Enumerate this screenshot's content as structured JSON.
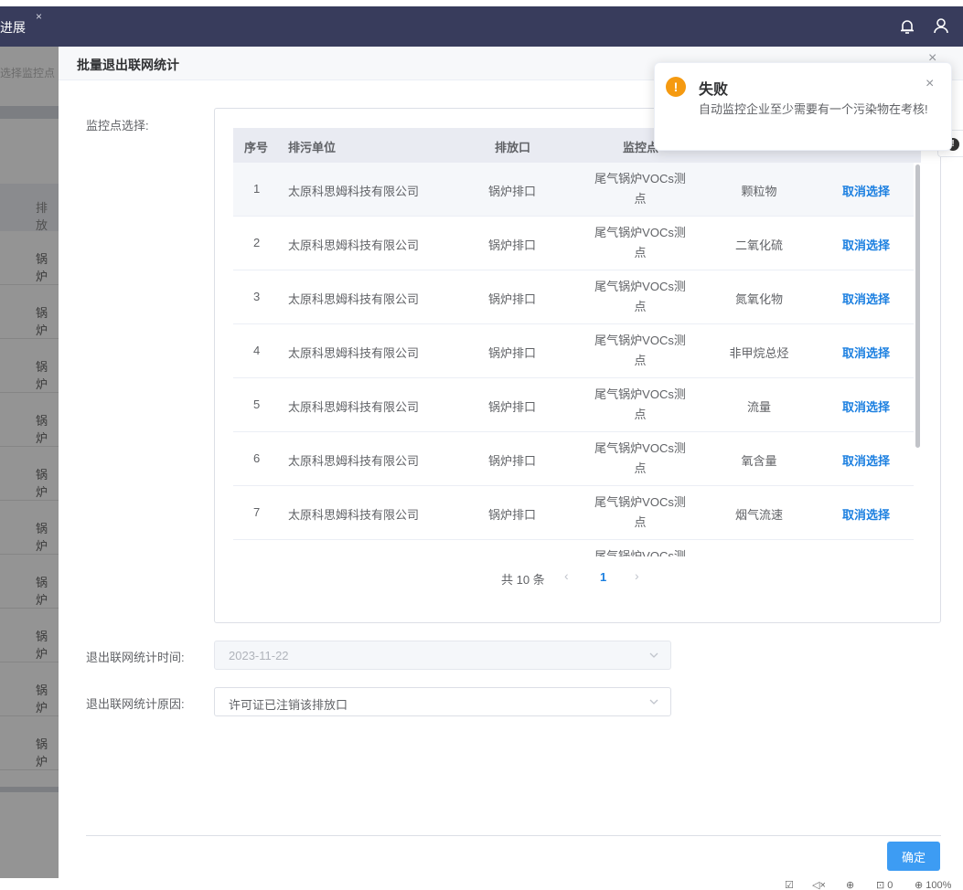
{
  "topbar": {
    "tab_label": "进展",
    "tab_close": "×",
    "bell_icon": "bell-icon",
    "user_icon": "user-icon"
  },
  "background": {
    "search_placeholder": "选择监控点",
    "header_text": "排放",
    "row_texts": [
      "锅炉",
      "锅炉",
      "锅炉",
      "锅炉",
      "锅炉",
      "锅炉",
      "锅炉",
      "锅炉",
      "锅炉",
      "锅炉"
    ]
  },
  "drawer": {
    "title": "批量退出联网统计",
    "close": "×",
    "monitor_label": "监控点选择:",
    "table": {
      "headers": {
        "index": "序号",
        "unit": "排污单位",
        "outlet": "排放口",
        "point": "监控点"
      },
      "rows": [
        {
          "index": "1",
          "unit": "太原科思姆科技有限公司",
          "outlet": "锅炉排口",
          "point": "尾气锅炉VOCs测点",
          "pollutant": "颗粒物",
          "action": "取消选择"
        },
        {
          "index": "2",
          "unit": "太原科思姆科技有限公司",
          "outlet": "锅炉排口",
          "point": "尾气锅炉VOCs测点",
          "pollutant": "二氧化硫",
          "action": "取消选择"
        },
        {
          "index": "3",
          "unit": "太原科思姆科技有限公司",
          "outlet": "锅炉排口",
          "point": "尾气锅炉VOCs测点",
          "pollutant": "氮氧化物",
          "action": "取消选择"
        },
        {
          "index": "4",
          "unit": "太原科思姆科技有限公司",
          "outlet": "锅炉排口",
          "point": "尾气锅炉VOCs测点",
          "pollutant": "非甲烷总烃",
          "action": "取消选择"
        },
        {
          "index": "5",
          "unit": "太原科思姆科技有限公司",
          "outlet": "锅炉排口",
          "point": "尾气锅炉VOCs测点",
          "pollutant": "流量",
          "action": "取消选择"
        },
        {
          "index": "6",
          "unit": "太原科思姆科技有限公司",
          "outlet": "锅炉排口",
          "point": "尾气锅炉VOCs测点",
          "pollutant": "氧含量",
          "action": "取消选择"
        },
        {
          "index": "7",
          "unit": "太原科思姆科技有限公司",
          "outlet": "锅炉排口",
          "point": "尾气锅炉VOCs测点",
          "pollutant": "烟气流速",
          "action": "取消选择"
        },
        {
          "index": "",
          "unit": "",
          "outlet": "",
          "point": "尾气锅炉VOCs测",
          "pollutant": "",
          "action": ""
        }
      ]
    },
    "pagination": {
      "total": "共 10 条",
      "prev": "‹",
      "current_page": "1",
      "next": "›"
    },
    "exit_time_label": "退出联网统计时间:",
    "exit_time_value": "2023-11-22",
    "exit_reason_label": "退出联网统计原因:",
    "exit_reason_value": "许可证已注销该排放口",
    "confirm_label": "确定"
  },
  "notification": {
    "icon": "!",
    "title": "失败",
    "message": "自动监控企业至少需要有一个污染物在考核!",
    "close": "×"
  },
  "side_handle": {
    "icon": "!"
  },
  "statusbar": {
    "items": [
      "☑",
      "◁×",
      "⊕",
      "⊡ 0",
      "⊕ 100%"
    ]
  },
  "colors": {
    "topbar": "#383c5c",
    "primary": "#3d9cf3",
    "link": "#1b7fe0",
    "warning": "#f59a11"
  }
}
